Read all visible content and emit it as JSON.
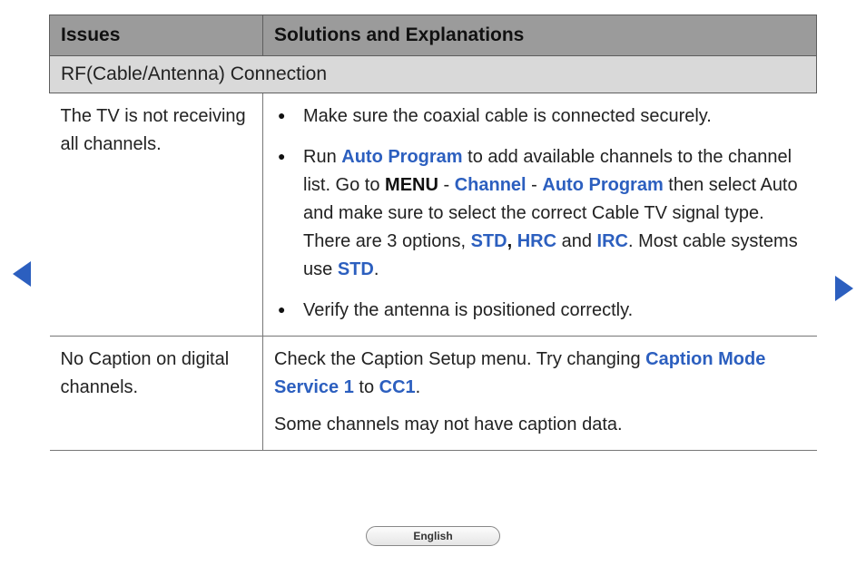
{
  "nav": {
    "previous": "previous page",
    "next": "next page"
  },
  "language": "English",
  "table": {
    "headers": {
      "col1": "Issues",
      "col2": "Solutions and Explanations"
    },
    "section": "RF(Cable/Antenna) Connection",
    "rows": [
      {
        "issue": "The TV is not receiving all channels.",
        "solution": {
          "bullets": [
            {
              "runs": [
                {
                  "t": "Make sure the coaxial cable is connected securely."
                }
              ]
            },
            {
              "runs": [
                {
                  "t": "Run "
                },
                {
                  "t": "Auto Program",
                  "cls": "term"
                },
                {
                  "t": " to add available channels to the channel list. Go to "
                },
                {
                  "t": "MENU",
                  "cls": "boldk"
                },
                {
                  "t": " - "
                },
                {
                  "t": "Channel",
                  "cls": "term"
                },
                {
                  "t": " - "
                },
                {
                  "t": "Auto Program",
                  "cls": "term"
                },
                {
                  "t": " then select Auto and make sure to select the correct Cable TV signal type. There are 3 options, "
                },
                {
                  "t": "STD",
                  "cls": "term"
                },
                {
                  "t": ", ",
                  "cls": "boldk"
                },
                {
                  "t": "HRC",
                  "cls": "term"
                },
                {
                  "t": " and "
                },
                {
                  "t": "IRC",
                  "cls": "term"
                },
                {
                  "t": ". Most cable systems use "
                },
                {
                  "t": "STD",
                  "cls": "term"
                },
                {
                  "t": "."
                }
              ]
            },
            {
              "runs": [
                {
                  "t": "Verify the antenna is positioned correctly."
                }
              ]
            }
          ]
        }
      },
      {
        "issue": "No Caption on digital channels.",
        "solution": {
          "paras": [
            {
              "runs": [
                {
                  "t": "Check the Caption Setup menu. Try changing "
                },
                {
                  "t": "Caption Mode Service 1",
                  "cls": "term"
                },
                {
                  "t": " to "
                },
                {
                  "t": "CC1",
                  "cls": "term"
                },
                {
                  "t": "."
                }
              ]
            },
            {
              "runs": [
                {
                  "t": "Some channels may not have caption data."
                }
              ]
            }
          ]
        }
      }
    ]
  }
}
